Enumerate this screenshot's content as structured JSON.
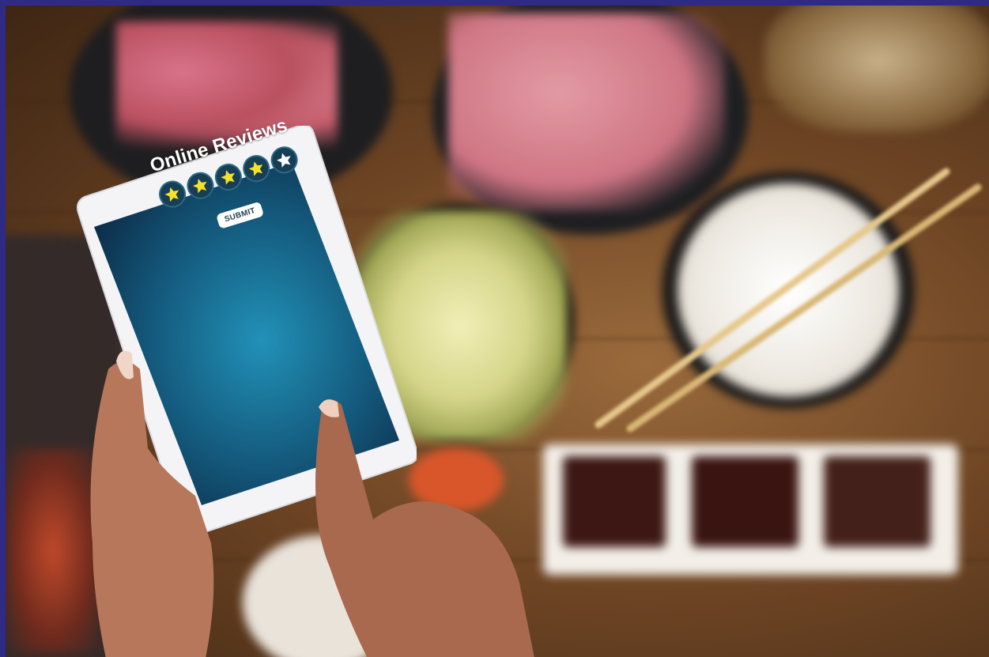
{
  "screen": {
    "title": "Online Reviews",
    "rating": {
      "filled": 4,
      "total": 5
    },
    "submit_label": "SUBMIT"
  },
  "colors": {
    "frame": "#2e2a86",
    "screen_center": "#1f7fa6",
    "screen_edge": "#0f2f4a",
    "star_filled": "#f5e12a",
    "star_empty": "#ffffff"
  },
  "icons": [
    "star-icon"
  ]
}
